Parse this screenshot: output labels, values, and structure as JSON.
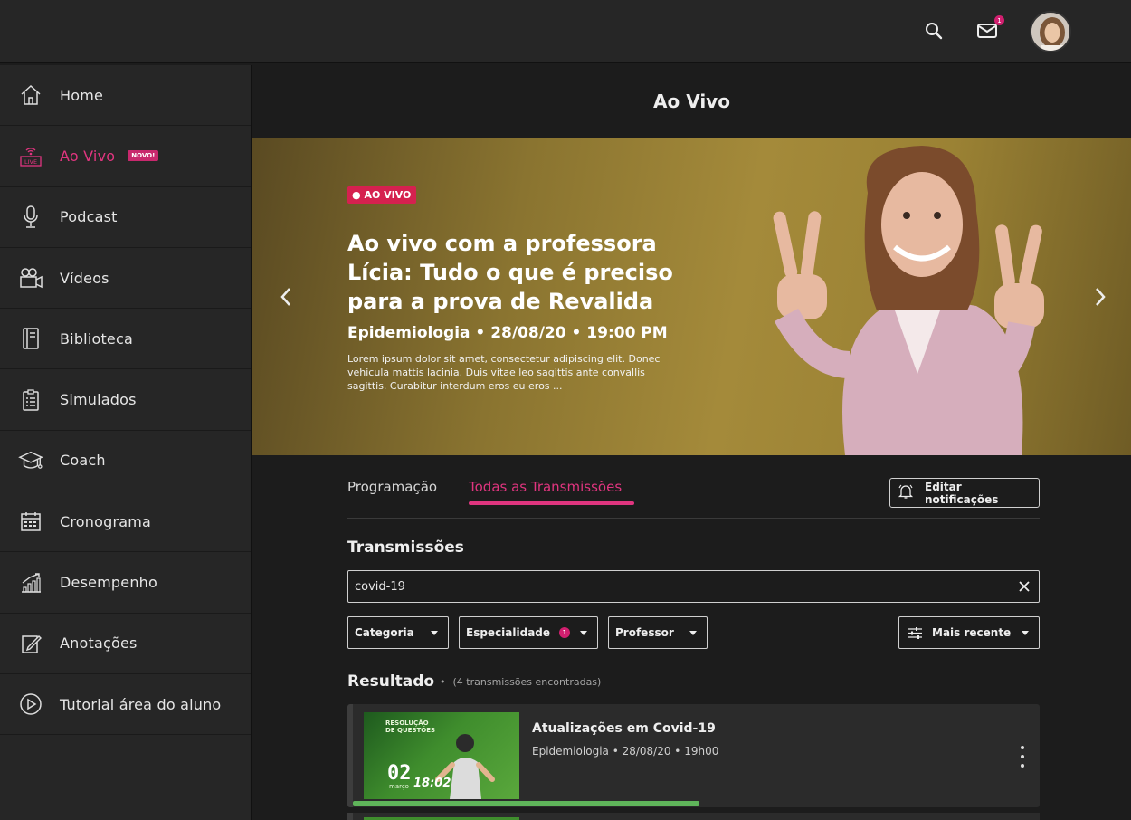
{
  "topbar": {
    "search_icon": "search-icon",
    "mail_icon": "mail-icon",
    "mail_badge": "1",
    "avatar": "user-avatar"
  },
  "sidebar": {
    "items": [
      {
        "label": "Home",
        "icon": "home-icon"
      },
      {
        "label": "Ao Vivo",
        "icon": "live-icon",
        "tag": "NOVO!",
        "active": true
      },
      {
        "label": "Podcast",
        "icon": "microphone-icon"
      },
      {
        "label": "Vídeos",
        "icon": "video-camera-icon"
      },
      {
        "label": "Biblioteca",
        "icon": "book-icon"
      },
      {
        "label": "Simulados",
        "icon": "clipboard-icon"
      },
      {
        "label": "Coach",
        "icon": "graduation-cap-icon"
      },
      {
        "label": "Cronograma",
        "icon": "calendar-icon"
      },
      {
        "label": "Desempenho",
        "icon": "chart-icon"
      },
      {
        "label": "Anotações",
        "icon": "note-icon"
      },
      {
        "label": "Tutorial área do aluno",
        "icon": "play-circle-icon"
      }
    ]
  },
  "page": {
    "title": "Ao Vivo"
  },
  "hero": {
    "badge": "AO VIVO",
    "title": "Ao vivo com a professora Lícia: Tudo o que é preciso para a prova de Revalida",
    "meta": "Epidemiologia  •  28/08/20  •  19:00 PM",
    "description": "Lorem ipsum dolor sit amet, consectetur adipiscing elit. Donec vehicula mattis lacinia. Duis vitae leo sagittis ante convallis sagittis. Curabitur interdum eros eu eros ..."
  },
  "tabs": [
    {
      "label": "Programação",
      "active": false
    },
    {
      "label": "Todas as Transmissões",
      "active": true
    }
  ],
  "notifications_button": "Editar notificações",
  "transmissions": {
    "title": "Transmissões",
    "search_value": "covid-19"
  },
  "filters": {
    "categoria": "Categoria",
    "especialidade": "Especialidade",
    "especialidade_count": "1",
    "professor": "Professor",
    "sort": "Mais recente"
  },
  "results": {
    "title": "Resultado",
    "count_text": "(4 transmissões encontradas)",
    "items": [
      {
        "title": "Atualizações em Covid-19",
        "meta": "Epidemiologia  •  28/08/20  •  19h00",
        "thumb_heading": "RESOLUÇÃO\nDE QUESTÕES",
        "thumb_day": "02",
        "thumb_month": "março",
        "thumb_time": "18:02",
        "progress": 0.5
      }
    ]
  },
  "colors": {
    "accent": "#e0357f",
    "live": "#d5214f",
    "progress": "#5fb45a",
    "sidebar_bg": "#262626",
    "main_bg": "#1c1c1c"
  }
}
